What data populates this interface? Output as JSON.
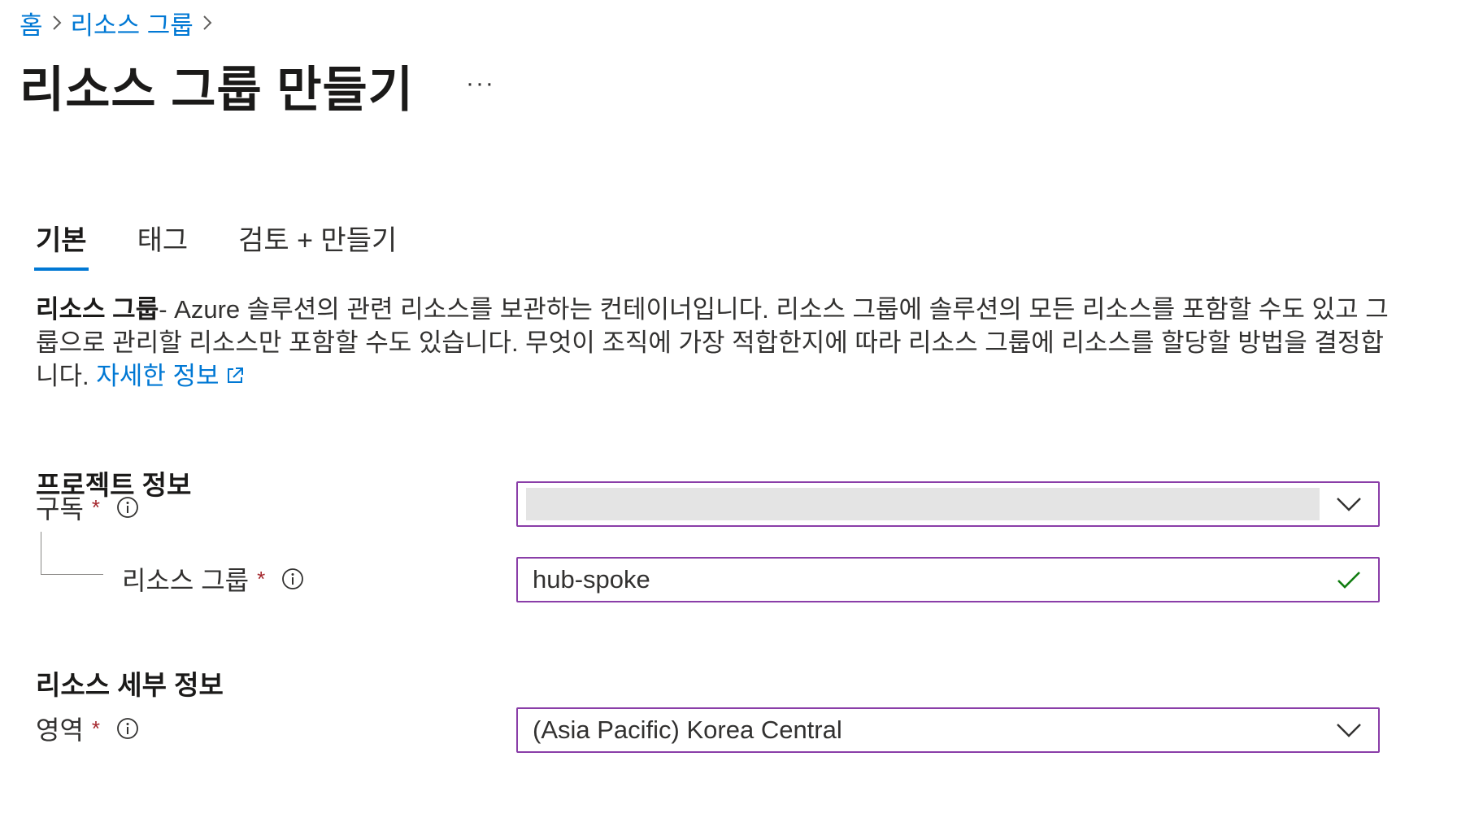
{
  "breadcrumb": {
    "home": "홈",
    "resource_groups": "리소스 그룹"
  },
  "header": {
    "title": "리소스 그룹 만들기",
    "more": "···"
  },
  "tabs": [
    {
      "label": "기본",
      "active": true
    },
    {
      "label": "태그",
      "active": false
    },
    {
      "label": "검토 + 만들기",
      "active": false
    }
  ],
  "description": {
    "term": "리소스 그룹",
    "text": "- Azure 솔루션의 관련 리소스를 보관하는 컨테이너입니다. 리소스 그룹에 솔루션의 모든 리소스를 포함할 수도 있고 그룹으로 관리할 리소스만 포함할 수도 있습니다. 무엇이 조직에 가장 적합한지에 따라 리소스 그룹에 리소스를 할당할 방법을 결정합니다.",
    "learn_more": "자세한 정보"
  },
  "project_section": {
    "title": "프로젝트 정보",
    "subscription_label": "구독",
    "subscription_value": "",
    "resource_group_label": "리소스 그룹",
    "resource_group_value": "hub-spoke"
  },
  "resource_section": {
    "title": "리소스 세부 정보",
    "region_label": "영역",
    "region_value": "(Asia Pacific) Korea Central"
  },
  "required_mark": "*",
  "colors": {
    "accent": "#0078d4",
    "required": "#a4262c",
    "control_border": "#8a3ea8",
    "valid_check": "#107c10"
  },
  "icons": [
    "chevron-right-icon",
    "info-icon",
    "external-link-icon",
    "chevron-down-icon",
    "checkmark-icon"
  ]
}
